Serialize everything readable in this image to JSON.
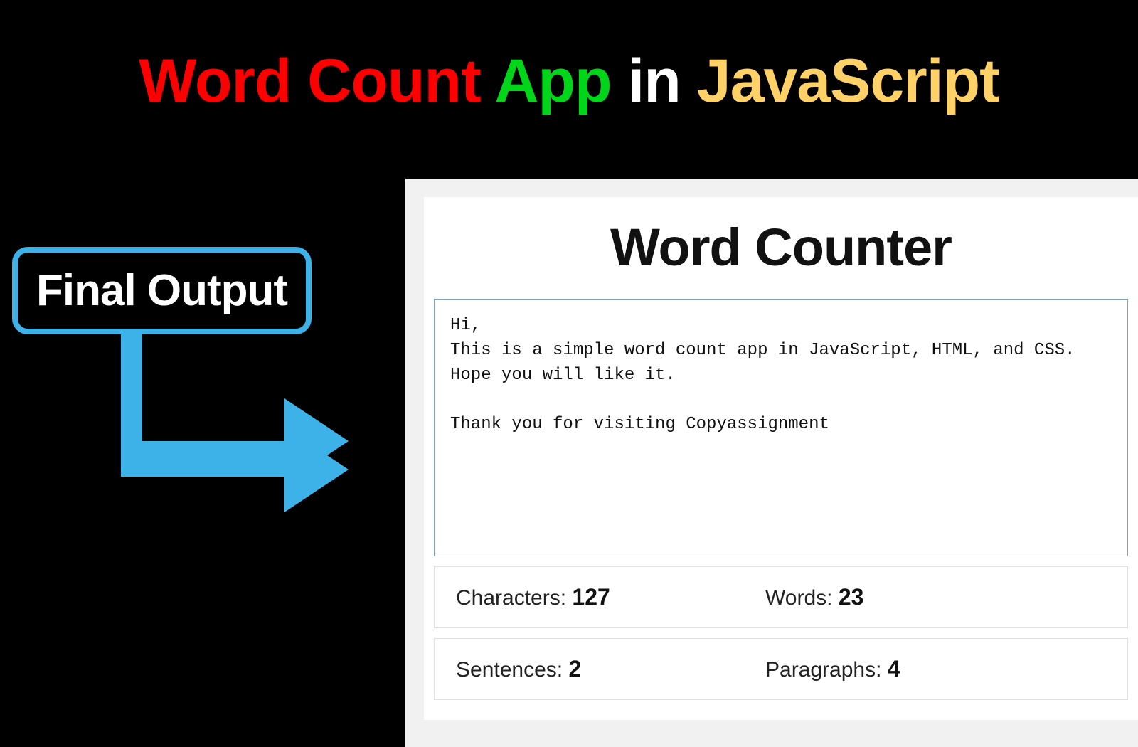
{
  "title": {
    "part1": "Word Count",
    "part2": "App",
    "part3": "in",
    "part4": "JavaScript"
  },
  "badge_label": "Final Output",
  "app": {
    "heading": "Word Counter",
    "textarea_value": "Hi,\nThis is a simple word count app in JavaScript, HTML, and CSS.\nHope you will like it.\n\nThank you for visiting Copyassignment",
    "stats": {
      "characters_label": "Characters: ",
      "characters": "127",
      "words_label": "Words: ",
      "words": "23",
      "sentences_label": "Sentences: ",
      "sentences": "2",
      "paragraphs_label": "Paragraphs: ",
      "paragraphs": "4"
    }
  },
  "colors": {
    "red": "#ff0000",
    "green": "#00d619",
    "yellow": "#ffd166",
    "blue": "#3db2e8"
  }
}
